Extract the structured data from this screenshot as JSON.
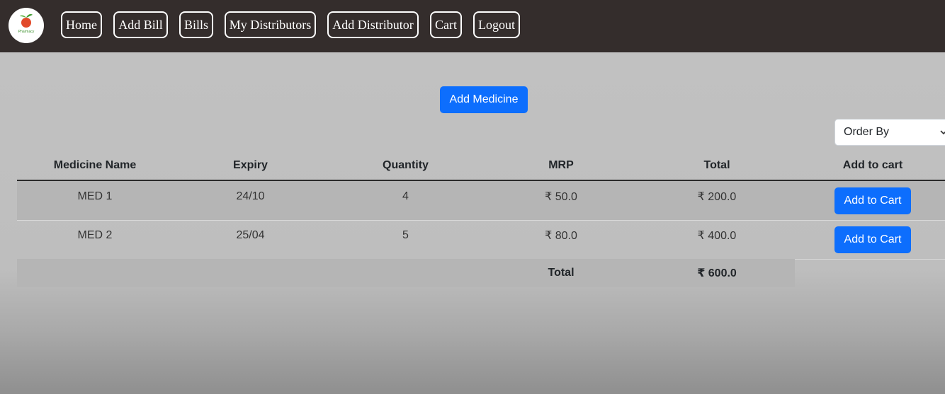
{
  "navbar": {
    "logo_text": "Pharmacy",
    "links": [
      {
        "label": "Home"
      },
      {
        "label": "Add Bill"
      },
      {
        "label": "Bills"
      },
      {
        "label": "My Distributors"
      },
      {
        "label": "Add Distributor"
      },
      {
        "label": "Cart"
      },
      {
        "label": "Logout"
      }
    ]
  },
  "actions": {
    "add_medicine_label": "Add Medicine"
  },
  "order_by": {
    "selected": "Order By"
  },
  "table": {
    "headers": [
      "Medicine Name",
      "Expiry",
      "Quantity",
      "MRP",
      "Total",
      "Add to cart"
    ],
    "rows": [
      {
        "name": "MED 1",
        "expiry": "24/10",
        "quantity": "4",
        "mrp": "₹ 50.0",
        "total": "₹ 200.0",
        "action_label": "Add to Cart"
      },
      {
        "name": "MED 2",
        "expiry": "25/04",
        "quantity": "5",
        "mrp": "₹ 80.0",
        "total": "₹ 400.0",
        "action_label": "Add to Cart"
      }
    ],
    "footer": {
      "label": "Total",
      "value": "₹ 600.0"
    }
  },
  "colors": {
    "navbar_bg": "#342d2c",
    "primary": "#0d6efd",
    "page_bg": "#c2c2c2"
  }
}
